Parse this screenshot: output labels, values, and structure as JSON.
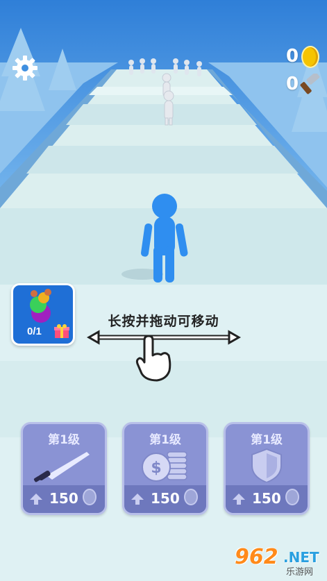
{
  "hud": {
    "coins": "0",
    "hammers": "0",
    "settings_icon": "gear-icon",
    "coin_icon": "coin-icon",
    "hammer_icon": "hammer-icon"
  },
  "gift": {
    "progress": "0/1",
    "icon": "gift-icon"
  },
  "hint": {
    "text": "长按并拖动可移动",
    "icon": "drag-hand-icon"
  },
  "upgrades": [
    {
      "level": "第1级",
      "price": "150",
      "icon": "sword-icon"
    },
    {
      "level": "第1级",
      "price": "150",
      "icon": "coins-icon"
    },
    {
      "level": "第1级",
      "price": "150",
      "icon": "shield-icon"
    }
  ],
  "watermark": {
    "brand": "962",
    "suffix": ".NET",
    "subtitle": "乐游网"
  },
  "colors": {
    "player": "#2f8ef0",
    "enemy": "#e6e9ee",
    "sky": "#3f8fe0",
    "road_light": "#e6f3f4",
    "road_dark": "#cfe7ea",
    "upgrade_card": "#8a93d4"
  }
}
